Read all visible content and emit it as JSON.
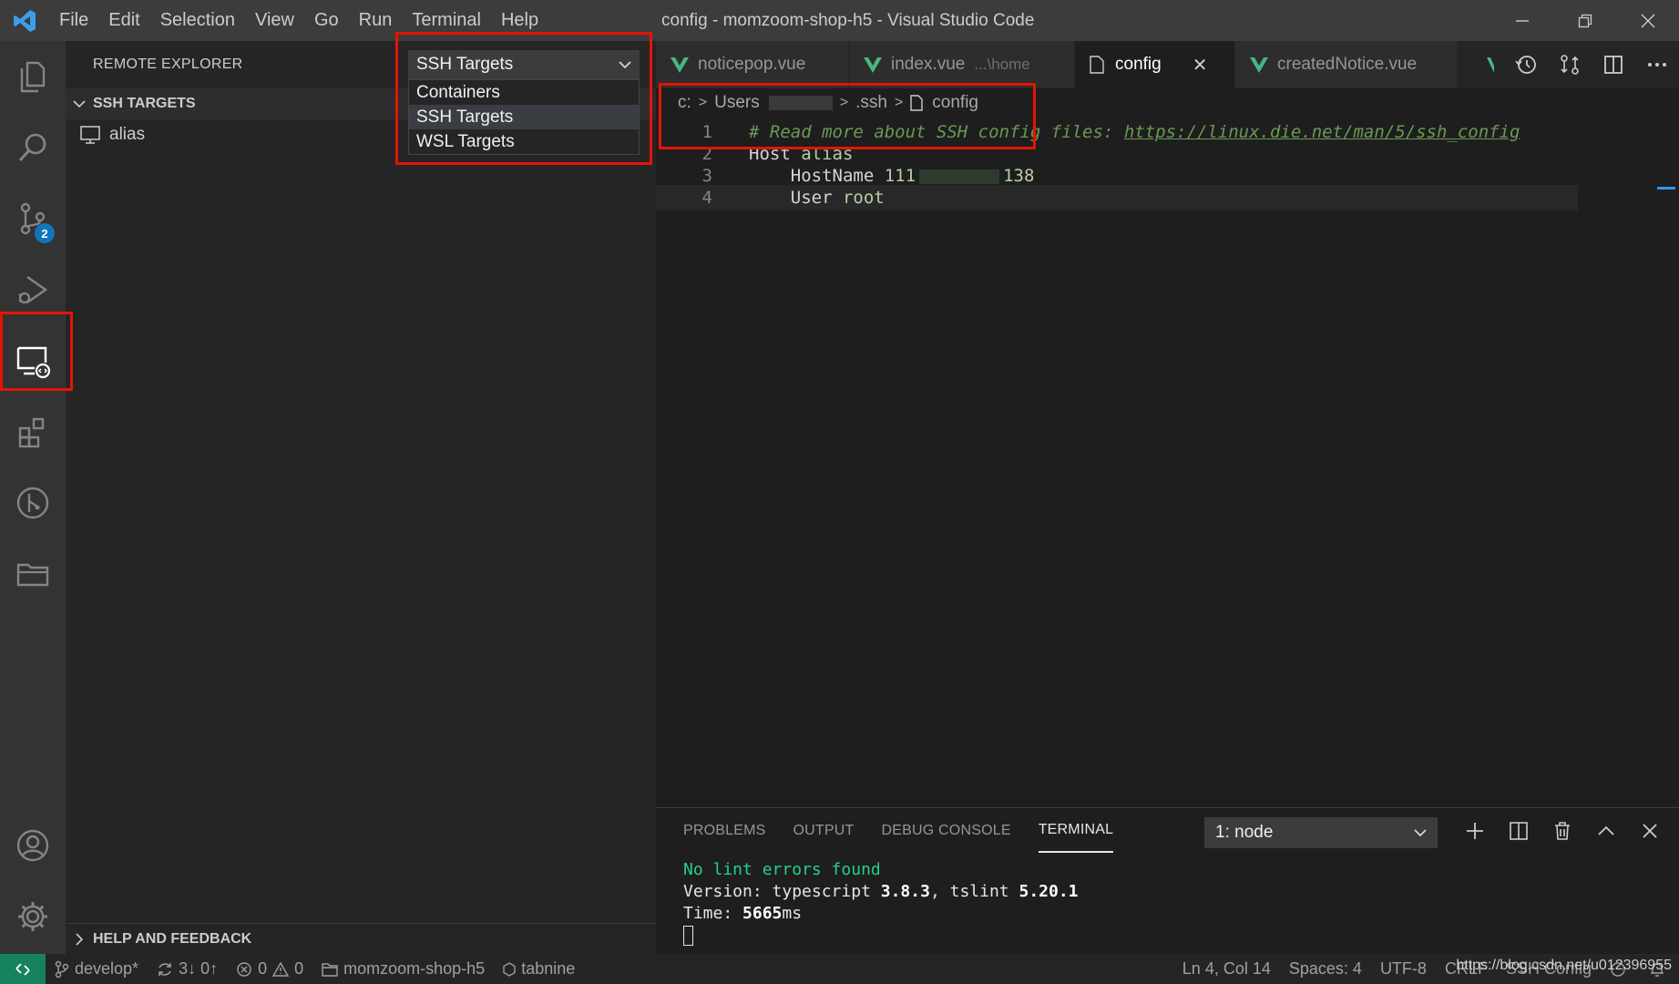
{
  "window": {
    "title": "config - momzoom-shop-h5 - Visual Studio Code"
  },
  "menu": {
    "items": [
      "File",
      "Edit",
      "Selection",
      "View",
      "Go",
      "Run",
      "Terminal",
      "Help"
    ]
  },
  "activity_bar": {
    "items": [
      "explorer-icon",
      "search-icon",
      "source-control-icon",
      "run-debug-icon",
      "remote-explorer-icon",
      "extensions-icon",
      "git-graph-icon",
      "folder-icon",
      "account-icon",
      "settings-gear-icon"
    ],
    "source_control_badge": "2"
  },
  "sidebar": {
    "title": "REMOTE EXPLORER",
    "section": "SSH TARGETS",
    "items": [
      {
        "label": "alias"
      }
    ],
    "footer_section": "HELP AND FEEDBACK"
  },
  "dropdown": {
    "selected": "SSH Targets",
    "options": [
      "Containers",
      "SSH Targets",
      "WSL Targets"
    ]
  },
  "tabs": [
    {
      "label": "noticepop.vue",
      "description": ""
    },
    {
      "label": "index.vue",
      "description": "...\\home"
    },
    {
      "label": "config",
      "description": ""
    },
    {
      "label": "createdNotice.vue",
      "description": ""
    }
  ],
  "breadcrumb": [
    "c:",
    "Users",
    ".ssh",
    "config"
  ],
  "editor": {
    "line_numbers": [
      "1",
      "2",
      "3",
      "4"
    ],
    "lines": [
      {
        "comment": "# Read more about SSH config files: ",
        "link": "https://linux.die.net/man/5/ssh_config"
      },
      {
        "key": "Host",
        "value": "alias"
      },
      {
        "key": "HostName",
        "value_start": "111",
        "value_end": "138"
      },
      {
        "key": "User",
        "value": "root"
      }
    ]
  },
  "panel": {
    "tabs": [
      "PROBLEMS",
      "OUTPUT",
      "DEBUG CONSOLE",
      "TERMINAL"
    ],
    "active_tab": "TERMINAL",
    "terminal_select": "1: node",
    "output": {
      "lint": "No lint errors found",
      "version_prefix": "Version: typescript ",
      "ts_version": "3.8.3",
      "version_mid": ", tslint ",
      "tslint_version": "5.20.1",
      "time_prefix": "Time: ",
      "time_value": "5665",
      "time_unit": "ms"
    }
  },
  "statusbar": {
    "branch": "develop*",
    "sync": "3↓ 0↑",
    "errors": "0",
    "warnings": "0",
    "folder": "momzoom-shop-h5",
    "tabnine": "tabnine",
    "position": "Ln 4, Col 14",
    "spaces": "Spaces: 4",
    "encoding": "UTF-8",
    "eol": "CRLF",
    "language": "SSH Config",
    "watermark": "https://blog.csdn.net/u012396955"
  },
  "colors": {
    "remote_indicator": "#16825d",
    "highlight_box": "#e51400",
    "vue": "#41b883",
    "badge": "#1177bb"
  }
}
